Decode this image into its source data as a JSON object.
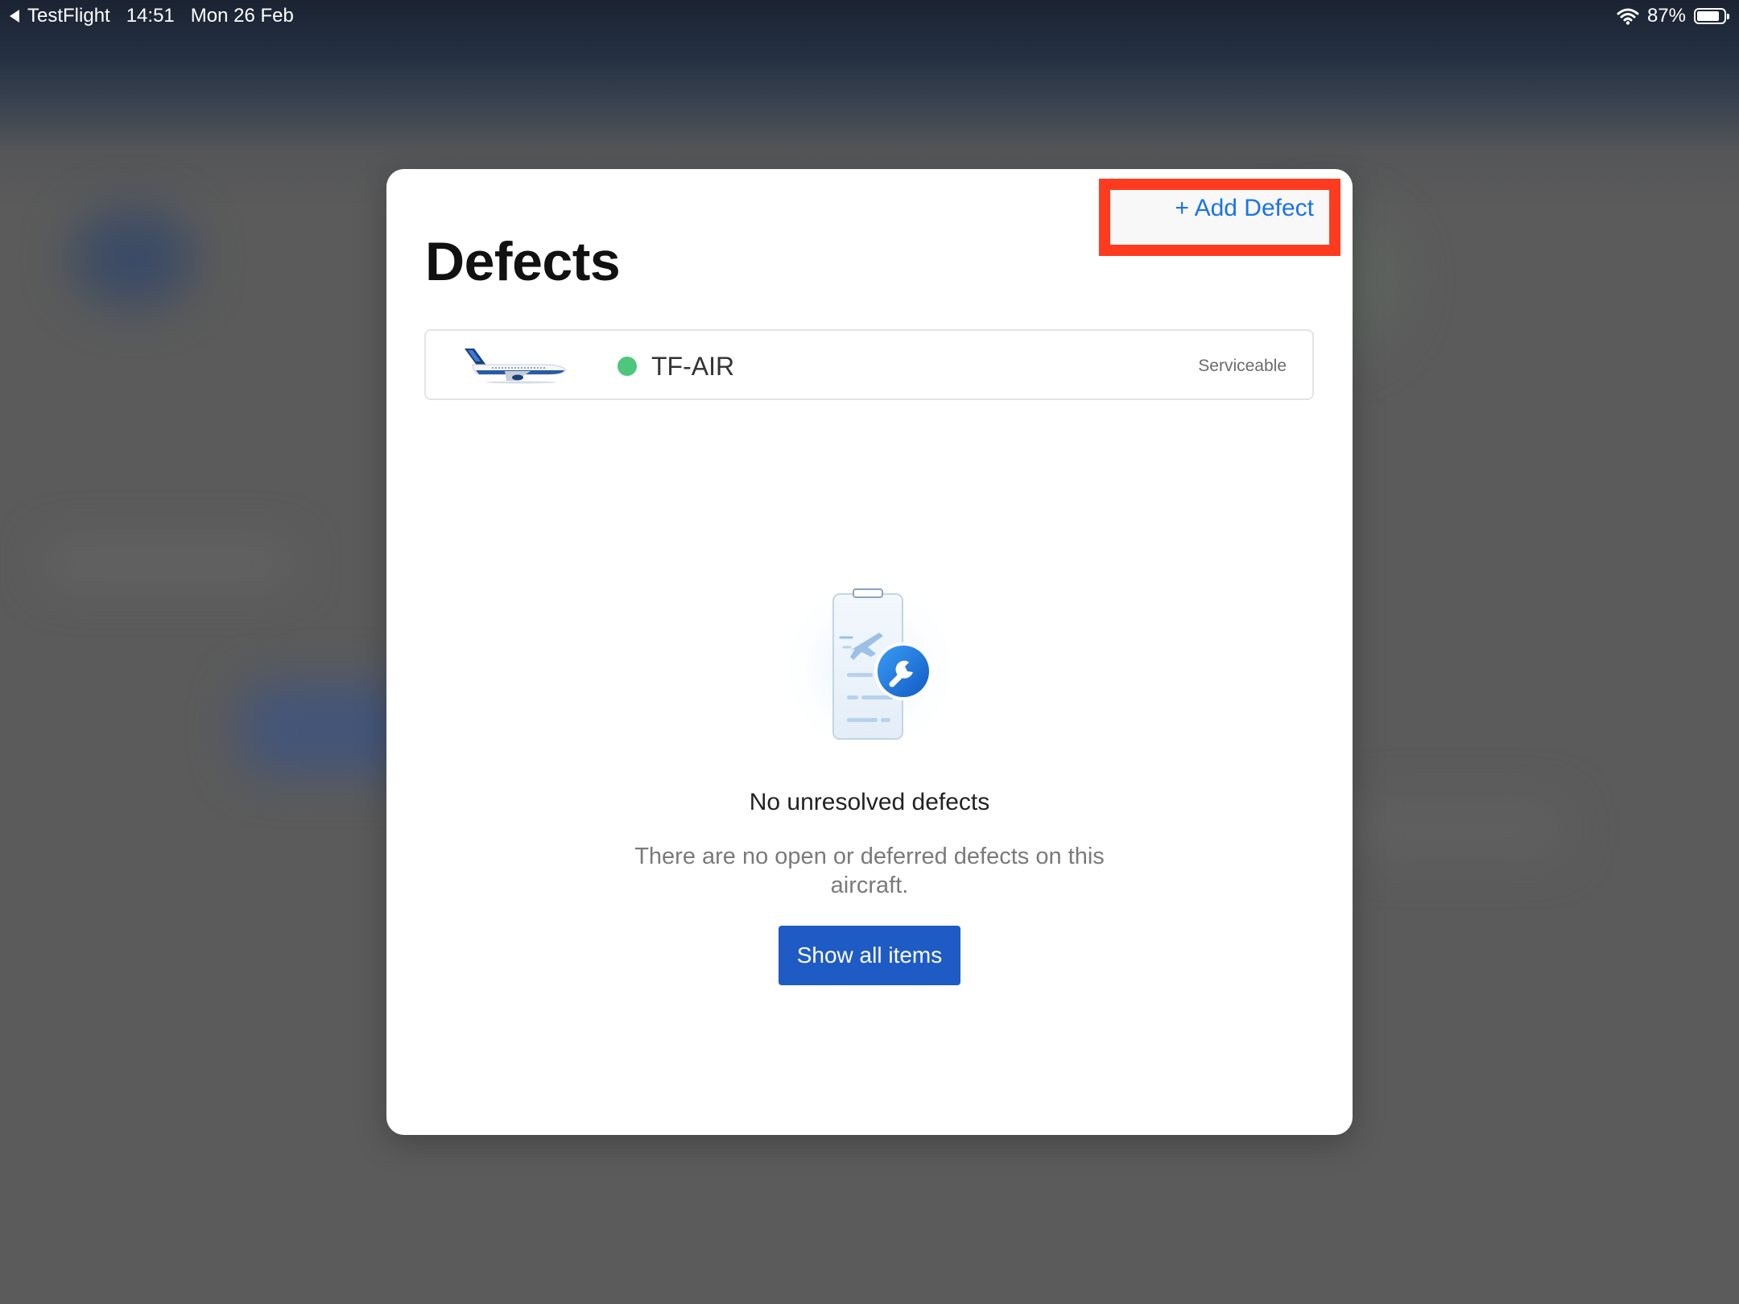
{
  "status_bar": {
    "back_app": "TestFlight",
    "time": "14:51",
    "date": "Mon 26 Feb",
    "battery_percent": "87%",
    "battery_level": 0.87
  },
  "modal": {
    "title": "Defects",
    "add_button_label": "+ Add Defect",
    "highlight_color": "#ff3b1f",
    "accent_color": "#1a73e8"
  },
  "aircraft": {
    "registration": "TF-AIR",
    "status": "Serviceable",
    "status_color": "#4cc77d"
  },
  "empty_state": {
    "title": "No unresolved defects",
    "description": "There are no open or deferred defects on this aircraft.",
    "button_label": "Show all items",
    "button_color": "#1f5bc4"
  },
  "icons": [
    "back-icon",
    "wifi-icon",
    "battery-icon",
    "aircraft-thumbnail",
    "clipboard-wrench-illustration"
  ]
}
